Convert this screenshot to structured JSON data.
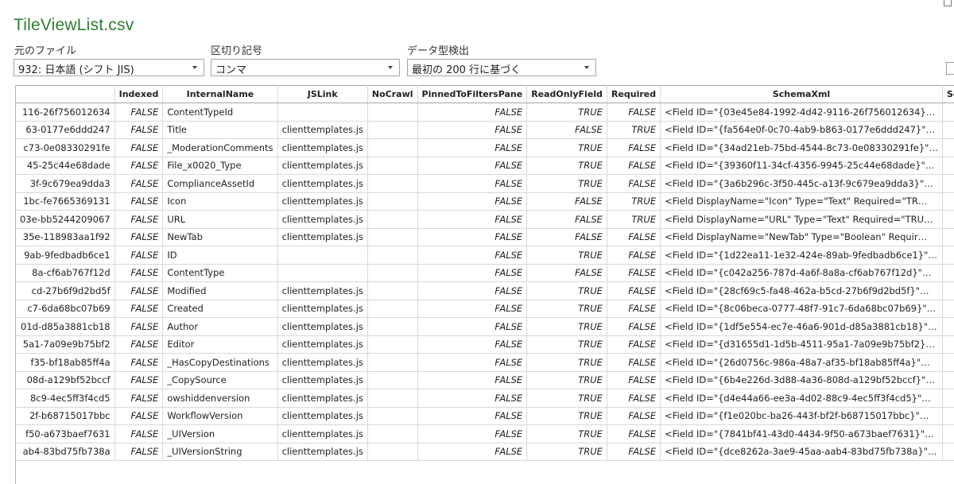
{
  "window": {
    "title": "TileViewList.csv"
  },
  "options": {
    "file_origin": {
      "label": "元のファイル",
      "value": "932: 日本語 (シフト JIS)"
    },
    "delimiter": {
      "label": "区切り記号",
      "value": "コンマ"
    },
    "type_detection": {
      "label": "データ型検出",
      "value": "最初の 200 行に基づく"
    }
  },
  "table": {
    "columns": [
      "",
      "Indexed",
      "InternalName",
      "JSLink",
      "NoCrawl",
      "PinnedToFiltersPane",
      "ReadOnlyField",
      "Required",
      "SchemaXml",
      "SchemaXml"
    ],
    "rows": [
      [
        "116-26f756012634",
        "FALSE",
        "ContentTypeId",
        "",
        "",
        "FALSE",
        "TRUE",
        "FALSE",
        "<Field ID=\"{03e45e84-1992-4d42-9116-26f756012634}…",
        ""
      ],
      [
        "63-0177e6ddd247",
        "FALSE",
        "Title",
        "clienttemplates.js",
        "",
        "FALSE",
        "FALSE",
        "TRUE",
        "<Field ID=\"{fa564e0f-0c70-4ab9-b863-0177e6ddd247}\"…",
        ""
      ],
      [
        "c73-0e08330291fe",
        "FALSE",
        "_ModerationComments",
        "clienttemplates.js",
        "",
        "FALSE",
        "TRUE",
        "FALSE",
        "<Field ID=\"{34ad21eb-75bd-4544-8c73-0e08330291fe}\"…",
        ""
      ],
      [
        "45-25c44e68dade",
        "FALSE",
        "File_x0020_Type",
        "clienttemplates.js",
        "",
        "FALSE",
        "TRUE",
        "FALSE",
        "<Field ID=\"{39360f11-34cf-4356-9945-25c44e68dade}\"…",
        ""
      ],
      [
        "3f-9c679ea9dda3",
        "FALSE",
        "ComplianceAssetId",
        "clienttemplates.js",
        "",
        "FALSE",
        "TRUE",
        "FALSE",
        "<Field ID=\"{3a6b296c-3f50-445c-a13f-9c679ea9dda3}\"…",
        ""
      ],
      [
        "1bc-fe7665369131",
        "FALSE",
        "Icon",
        "clienttemplates.js",
        "",
        "FALSE",
        "FALSE",
        "TRUE",
        "<Field DisplayName=\"Icon\" Type=\"Text\" Required=\"TR…",
        ""
      ],
      [
        "03e-bb5244209067",
        "FALSE",
        "URL",
        "clienttemplates.js",
        "",
        "FALSE",
        "FALSE",
        "TRUE",
        "<Field DisplayName=\"URL\" Type=\"Text\" Required=\"TRU…",
        ""
      ],
      [
        "35e-118983aa1f92",
        "FALSE",
        "NewTab",
        "clienttemplates.js",
        "",
        "FALSE",
        "FALSE",
        "FALSE",
        "<Field DisplayName=\"NewTab\" Type=\"Boolean\" Requir…",
        ""
      ],
      [
        "9ab-9fedbadb6ce1",
        "FALSE",
        "ID",
        "",
        "",
        "FALSE",
        "TRUE",
        "FALSE",
        "<Field ID=\"{1d22ea11-1e32-424e-89ab-9fedbadb6ce1}\"…",
        ""
      ],
      [
        "8a-cf6ab767f12d",
        "FALSE",
        "ContentType",
        "",
        "",
        "FALSE",
        "FALSE",
        "FALSE",
        "<Field ID=\"{c042a256-787d-4a6f-8a8a-cf6ab767f12d}\"…",
        ""
      ],
      [
        "cd-27b6f9d2bd5f",
        "FALSE",
        "Modified",
        "clienttemplates.js",
        "",
        "FALSE",
        "TRUE",
        "FALSE",
        "<Field ID=\"{28cf69c5-fa48-462a-b5cd-27b6f9d2bd5f}\"…",
        ""
      ],
      [
        "c7-6da68bc07b69",
        "FALSE",
        "Created",
        "clienttemplates.js",
        "",
        "FALSE",
        "TRUE",
        "FALSE",
        "<Field ID=\"{8c06beca-0777-48f7-91c7-6da68bc07b69}\"…",
        ""
      ],
      [
        "01d-d85a3881cb18",
        "FALSE",
        "Author",
        "clienttemplates.js",
        "",
        "FALSE",
        "TRUE",
        "FALSE",
        "<Field ID=\"{1df5e554-ec7e-46a6-901d-d85a3881cb18}\"…",
        ""
      ],
      [
        "5a1-7a09e9b75bf2",
        "FALSE",
        "Editor",
        "clienttemplates.js",
        "",
        "FALSE",
        "TRUE",
        "FALSE",
        "<Field ID=\"{d31655d1-1d5b-4511-95a1-7a09e9b75bf2}…",
        ""
      ],
      [
        "f35-bf18ab85ff4a",
        "FALSE",
        "_HasCopyDestinations",
        "clienttemplates.js",
        "",
        "FALSE",
        "TRUE",
        "FALSE",
        "<Field ID=\"{26d0756c-986a-48a7-af35-bf18ab85ff4a}\"…",
        ""
      ],
      [
        "08d-a129bf52bccf",
        "FALSE",
        "_CopySource",
        "clienttemplates.js",
        "",
        "FALSE",
        "TRUE",
        "FALSE",
        "<Field ID=\"{6b4e226d-3d88-4a36-808d-a129bf52bccf}\"…",
        ""
      ],
      [
        "8c9-4ec5ff3f4cd5",
        "FALSE",
        "owshiddenversion",
        "clienttemplates.js",
        "",
        "FALSE",
        "TRUE",
        "FALSE",
        "<Field ID=\"{d4e44a66-ee3a-4d02-88c9-4ec5ff3f4cd5}\"…",
        ""
      ],
      [
        "2f-b68715017bbc",
        "FALSE",
        "WorkflowVersion",
        "clienttemplates.js",
        "",
        "FALSE",
        "TRUE",
        "FALSE",
        "<Field ID=\"{f1e020bc-ba26-443f-bf2f-b68715017bbc}\"…",
        ""
      ],
      [
        "f50-a673baef7631",
        "FALSE",
        "_UIVersion",
        "clienttemplates.js",
        "",
        "FALSE",
        "TRUE",
        "FALSE",
        "<Field ID=\"{7841bf41-43d0-4434-9f50-a673baef7631}\"…",
        ""
      ],
      [
        "ab4-83bd75fb738a",
        "FALSE",
        "_UIVersionString",
        "clienttemplates.js",
        "",
        "FALSE",
        "TRUE",
        "FALSE",
        "<Field ID=\"{dce8262a-3ae9-45aa-aab4-83bd75fb738a}\"…",
        ""
      ]
    ]
  }
}
